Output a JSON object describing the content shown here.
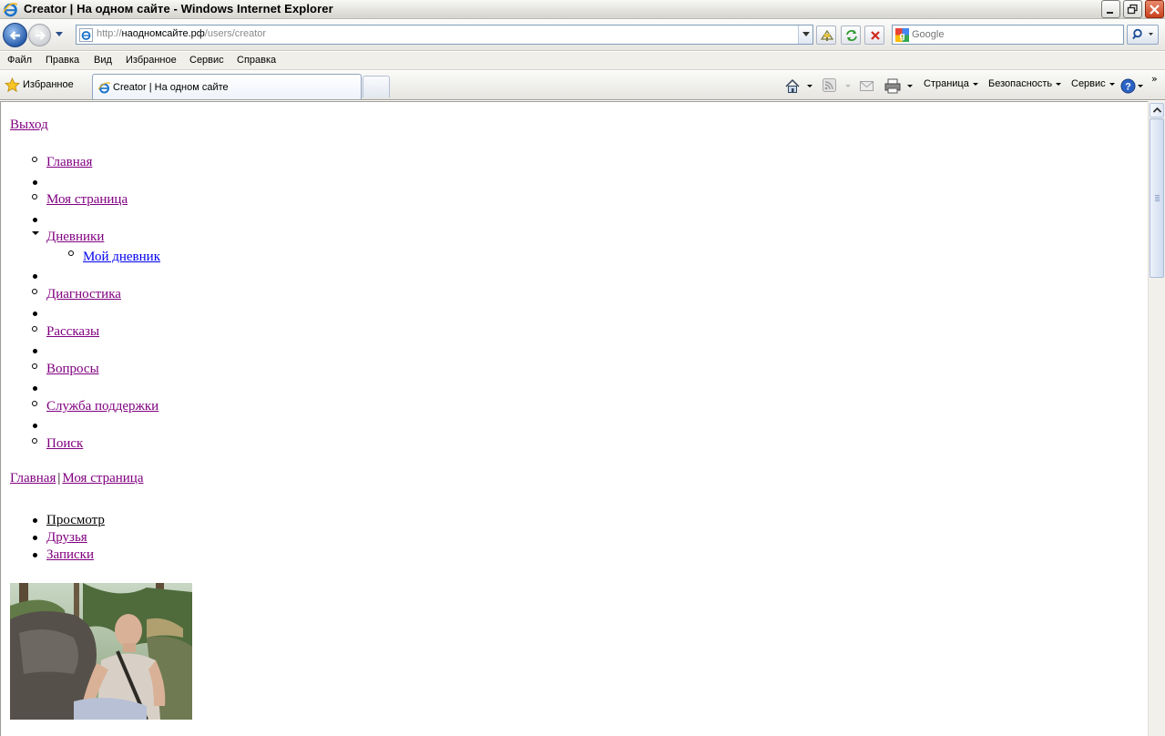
{
  "window": {
    "title": "Creator | На одном сайте - Windows Internet Explorer"
  },
  "address": {
    "url_prefix": "http://",
    "url_host": "наодномсайте.рф",
    "url_path": "/users/creator",
    "search_placeholder": "Google"
  },
  "menu": {
    "items": [
      "Файл",
      "Правка",
      "Вид",
      "Избранное",
      "Сервис",
      "Справка"
    ]
  },
  "toolbar": {
    "favorites_label": "Избранное",
    "tab_title": "Creator | На одном сайте",
    "page_label": "Страница",
    "safety_label": "Безопасность",
    "tools_label": "Сервис",
    "chevron": "»"
  },
  "content": {
    "logout": "Выход",
    "nav": {
      "home": "Главная",
      "my_page": "Моя страница",
      "diaries": "Дневники",
      "my_diary": "Мой дневник",
      "diagnostics": "Диагностика",
      "stories": "Рассказы",
      "questions": "Вопросы",
      "support": "Служба поддержки",
      "search": "Поиск"
    },
    "breadcrumb": {
      "home": "Главная",
      "separator": "|",
      "my_page": "Моя страница"
    },
    "profile_tabs": {
      "view": "Просмотр",
      "friends": "Друзья",
      "notes": "Записки"
    }
  },
  "colors": {
    "visited_link": "#800080",
    "unvisited_link": "#0000ee",
    "current_link": "#000000"
  }
}
